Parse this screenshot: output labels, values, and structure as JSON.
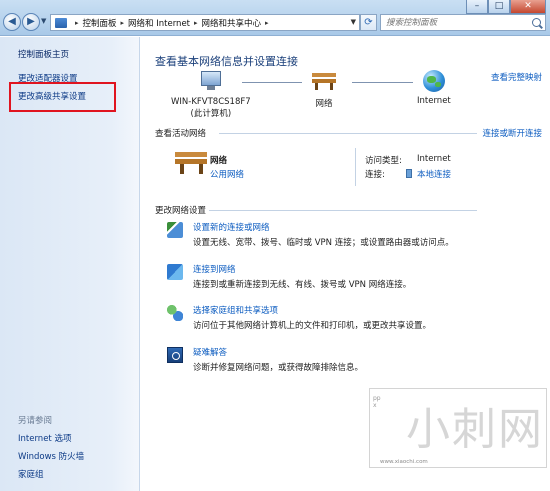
{
  "address_bar": {
    "breadcrumbs": [
      "控制面板",
      "网络和 Internet",
      "网络和共享中心"
    ],
    "search_placeholder": "搜索控制面板"
  },
  "window_controls": {
    "minimize": "–",
    "maximize": "□",
    "close": "✕"
  },
  "left_pane": {
    "home": "控制面板主页",
    "links": [
      "更改适配器设置",
      "更改高级共享设置"
    ],
    "highlighted_index": 1,
    "see_also_title": "另请参阅",
    "see_also": [
      "Internet 选项",
      "Windows 防火墙",
      "家庭组"
    ]
  },
  "main": {
    "title": "查看基本网络信息并设置连接",
    "full_map": "查看完整映射",
    "map": {
      "computer_name": "WIN-KFVT8CS18F7",
      "computer_sub": "(此计算机)",
      "network": "网络",
      "internet": "Internet"
    },
    "active_networks": {
      "label": "查看活动网络",
      "connect_link": "连接或断开连接",
      "network_name": "网络",
      "network_type": "公用网络",
      "access_type_key": "访问类型:",
      "access_type_val": "Internet",
      "connection_key": "连接:",
      "connection_val": "本地连接"
    },
    "change_settings": {
      "label": "更改网络设置",
      "tasks": [
        {
          "title": "设置新的连接或网络",
          "desc": "设置无线、宽带、拨号、临时或 VPN 连接；或设置路由器或访问点。",
          "icon": "network-setup-icon"
        },
        {
          "title": "连接到网络",
          "desc": "连接到或重新连接到无线、有线、拨号或 VPN 网络连接。",
          "icon": "connect-network-icon"
        },
        {
          "title": "选择家庭组和共享选项",
          "desc": "访问位于其他网络计算机上的文件和打印机，或更改共享设置。",
          "icon": "homegroup-icon"
        },
        {
          "title": "疑难解答",
          "desc": "诊断并修复网络问题，或获得故障排除信息。",
          "icon": "troubleshoot-icon"
        }
      ]
    }
  },
  "watermark": {
    "text": "小刺网",
    "url": "www.xiaochi.com"
  },
  "colors": {
    "link": "#0c5cc0",
    "highlight_border": "#e0141f",
    "title": "#1a3f7a"
  }
}
